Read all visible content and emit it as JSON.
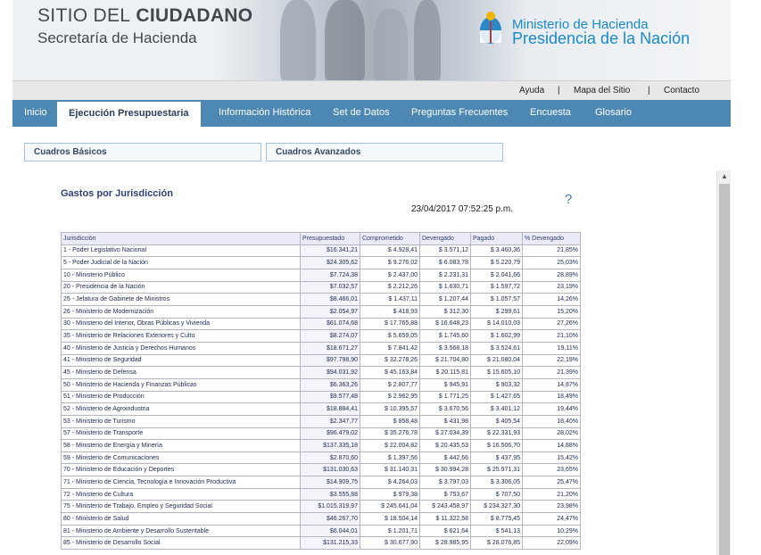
{
  "header": {
    "site_title_bold": "SITIO DEL",
    "site_title_rest": "CIUDADANO",
    "site_subtitle": "Secretaría de Hacienda",
    "ministry_line1": "Ministerio de Hacienda",
    "ministry_line2": "Presidencia de la Nación"
  },
  "util_links": {
    "ayuda": "Ayuda",
    "sep": "|",
    "mapa": "Mapa del Sitio",
    "contacto": "Contacto"
  },
  "nav": {
    "inicio": "Inicio",
    "ejecucion": "Ejecución Presupuestaria",
    "informacion": "Información Histórica",
    "set": "Set de Datos",
    "preguntas": "Preguntas Frecuentes",
    "encuesta": "Encuesta",
    "glosario": "Glosario"
  },
  "subtabs": {
    "basicos": "Cuadros Básicos",
    "avanzados": "Cuadros Avanzados"
  },
  "report": {
    "title": "Gastos por Jurisdicción",
    "timestamp": "23/04/2017 07:52:25 p.m.",
    "help": "?"
  },
  "table": {
    "headers": [
      "Jurisdicción",
      "Presupuestado",
      "Comprometido",
      "Devengado",
      "Pagado",
      "% Devengado"
    ],
    "rows": [
      [
        "1 - Poder Legislativo Nacional",
        "$16.341,21",
        "$ 4.928,41",
        "$ 3.571,12",
        "$ 3.460,36",
        "21,85%"
      ],
      [
        "5 - Poder Judicial de la Nación",
        "$24.305,62",
        "$ 9.276,02",
        "$ 6.083,78",
        "$ 5.220,79",
        "25,03%"
      ],
      [
        "10 - Ministerio Público",
        "$7.724,38",
        "$ 2.437,00",
        "$ 2.231,31",
        "$ 2.041,66",
        "28,89%"
      ],
      [
        "20 - Presidencia de la Nación",
        "$7.032,57",
        "$ 2.212,26",
        "$ 1.630,71",
        "$ 1.597,72",
        "23,19%"
      ],
      [
        "25 - Jefatura de Gabinete de Ministros",
        "$8.466,01",
        "$ 1.437,11",
        "$ 1.207,44",
        "$ 1.057,57",
        "14,26%"
      ],
      [
        "26 - Ministerio de Modernización",
        "$2.054,97",
        "$ 418,93",
        "$ 312,30",
        "$ 299,61",
        "15,20%"
      ],
      [
        "30 - Ministerio del Interior, Obras Públicas y Vivienda",
        "$61.074,68",
        "$ 17.765,88",
        "$ 16.648,23",
        "$ 14.010,03",
        "27,26%"
      ],
      [
        "35 - Ministerio de Relaciones Exteriores y Culto",
        "$8.274,07",
        "$ 5.659,05",
        "$ 1.745,60",
        "$ 1.602,99",
        "21,10%"
      ],
      [
        "40 - Ministerio de Justicia y Derechos Humanos",
        "$18.671,27",
        "$ 7.841,42",
        "$ 3.568,18",
        "$ 3.524,61",
        "19,11%"
      ],
      [
        "41 - Ministerio de Seguridad",
        "$97.798,90",
        "$ 32.278,26",
        "$ 21.704,80",
        "$ 21.080,04",
        "22,19%"
      ],
      [
        "45 - Ministerio de Defensa",
        "$94.031,92",
        "$ 45.163,84",
        "$ 20.115,81",
        "$ 15.605,10",
        "21,39%"
      ],
      [
        "50 - Ministerio de Hacienda y Finanzas Públicas",
        "$6.363,26",
        "$ 2.807,77",
        "$ 945,91",
        "$ 903,32",
        "14,87%"
      ],
      [
        "51 - Ministerio de Producción",
        "$9.577,48",
        "$ 2.962,95",
        "$ 1.771,25",
        "$ 1.427,65",
        "18,49%"
      ],
      [
        "52 - Ministerio de Agroindustria",
        "$18.884,41",
        "$ 10.395,57",
        "$ 3.670,56",
        "$ 3.401,12",
        "19,44%"
      ],
      [
        "53 - Ministerio de Turismo",
        "$2.347,77",
        "$ 858,48",
        "$ 431,98",
        "$ 405,54",
        "18,40%"
      ],
      [
        "57 - Ministerio de Transporte",
        "$96.479,02",
        "$ 35.276,78",
        "$ 27.034,39",
        "$ 22.331,93",
        "28,02%"
      ],
      [
        "58 - Ministerio de Energía y Minería",
        "$137.335,18",
        "$ 22.004,82",
        "$ 20.435,53",
        "$ 16.506,70",
        "14,88%"
      ],
      [
        "59 - Ministerio de Comunicaciones",
        "$2.870,60",
        "$ 1.397,56",
        "$ 442,66",
        "$ 437,95",
        "15,42%"
      ],
      [
        "70 - Ministerio de Educación y Deportes",
        "$131.030,63",
        "$ 31.140,31",
        "$ 30.994,28",
        "$ 25.971,31",
        "23,65%"
      ],
      [
        "71 - Ministerio de Ciencia, Tecnología e Innovación Productiva",
        "$14.909,75",
        "$ 4.264,03",
        "$ 3.797,03",
        "$ 3.306,05",
        "25,47%"
      ],
      [
        "72 - Ministerio de Cultura",
        "$3.555,88",
        "$ 979,38",
        "$ 753,67",
        "$ 707,50",
        "21,20%"
      ],
      [
        "75 - Ministerio de Trabajo, Empleo y Seguridad Social",
        "$1.015.319,97",
        "$ 245.641,04",
        "$ 243.458,97",
        "$ 234.327,30",
        "23,98%"
      ],
      [
        "80 - Ministerio de Salud",
        "$46.267,70",
        "$ 18.504,14",
        "$ 11.322,58",
        "$ 8.775,45",
        "24,47%"
      ],
      [
        "81 - Ministerio de Ambiente y Desarrollo Sustentable",
        "$6.044,01",
        "$ 1.201,71",
        "$ 621,64",
        "$ 541,13",
        "10,29%"
      ],
      [
        "85 - Ministerio de Desarrollo Social",
        "$131.215,33",
        "$ 30.677,90",
        "$ 28.985,95",
        "$ 28.076,85",
        "22,09%"
      ]
    ]
  },
  "colors": {
    "nav_bg": "#4d88b4",
    "brand_blue": "#1a8ac7",
    "title_navy": "#2f3f7a"
  }
}
